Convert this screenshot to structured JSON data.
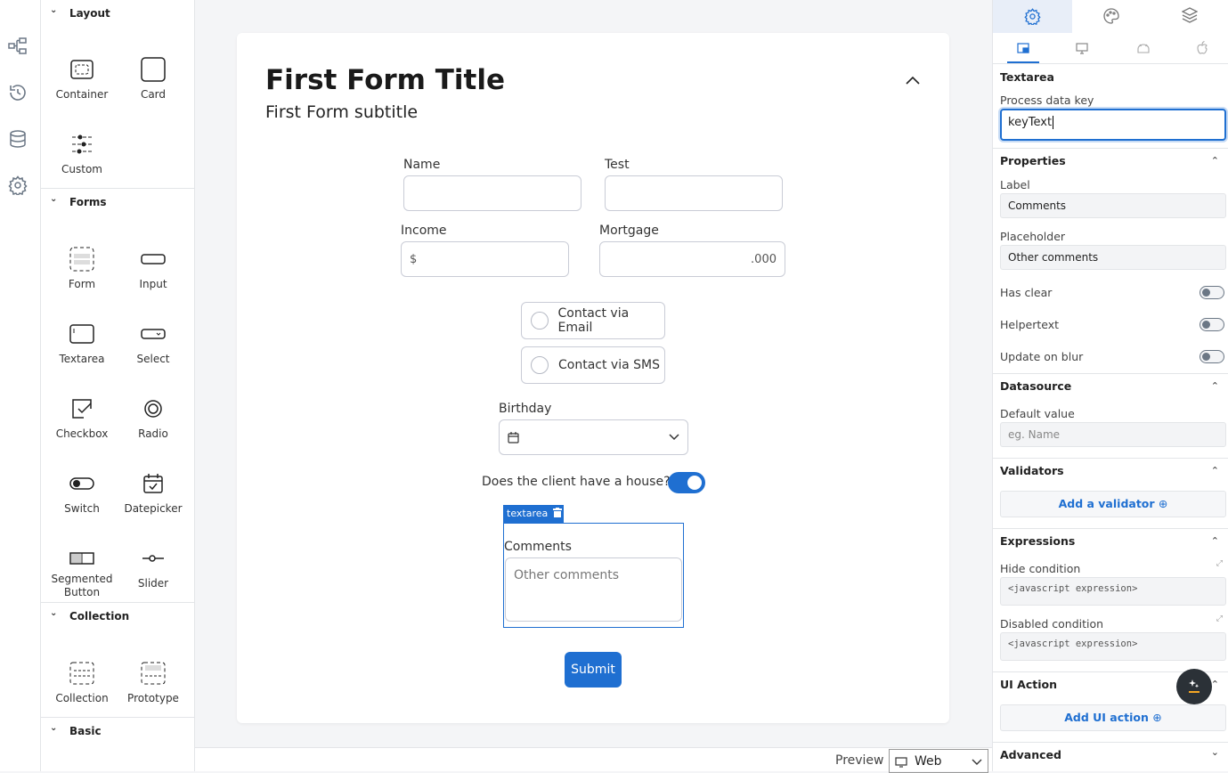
{
  "rail": {
    "icons": [
      "flow-icon",
      "history-icon",
      "database-icon",
      "settings-icon"
    ]
  },
  "palette": {
    "sections": [
      {
        "title": "Layout",
        "items": [
          "Container",
          "Card",
          "Custom"
        ]
      },
      {
        "title": "Forms",
        "items": [
          "Form",
          "Input",
          "Textarea",
          "Select",
          "Checkbox",
          "Radio",
          "Switch",
          "Datepicker",
          "Segmented Button",
          "Slider"
        ]
      },
      {
        "title": "Collection",
        "items": [
          "Collection",
          "Prototype"
        ]
      },
      {
        "title": "Basic",
        "items": []
      }
    ]
  },
  "form": {
    "title": "First Form Title",
    "subtitle": "First Form subtitle",
    "fields": {
      "name": "Name",
      "test": "Test",
      "income": "Income",
      "income_prefix": "$",
      "mortgage": "Mortgage",
      "mortgage_placeholder": ".000"
    },
    "radios": [
      "Contact via Email",
      "Contact via SMS"
    ],
    "birthday": "Birthday",
    "switch_label": "Does the client have a house?",
    "switch_on": true,
    "selected_tag": "textarea",
    "comments_label": "Comments",
    "comments_placeholder": "Other comments",
    "submit": "Submit"
  },
  "bottom": {
    "preview": "Preview",
    "platform": "Web"
  },
  "panel": {
    "tabs": [
      "settings-icon",
      "palette-icon",
      "layers-icon"
    ],
    "platform_tabs": [
      "responsive-icon",
      "desktop-icon",
      "android-icon",
      "apple-icon"
    ],
    "component": "Textarea",
    "process_key_label": "Process data key",
    "process_key_value": "keyText",
    "properties": {
      "title": "Properties",
      "label_label": "Label",
      "label_value": "Comments",
      "placeholder_label": "Placeholder",
      "placeholder_value": "Other comments",
      "has_clear": "Has clear",
      "helpertext": "Helpertext",
      "update_on_blur": "Update on blur",
      "toggles": [
        false,
        false,
        false
      ]
    },
    "datasource": {
      "title": "Datasource",
      "default_label": "Default value",
      "default_placeholder": "eg. Name"
    },
    "validators": {
      "title": "Validators",
      "button": "Add a validator"
    },
    "expressions": {
      "title": "Expressions",
      "hide": "Hide condition",
      "disabled": "Disabled condition",
      "placeholder": "<javascript expression>"
    },
    "ui_action": {
      "title": "UI Action",
      "button": "Add UI action"
    },
    "advanced": {
      "title": "Advanced"
    }
  },
  "colors": {
    "accent": "#1f6fd1",
    "fab": "#2b3137",
    "fab_accent": "#f5a623"
  }
}
